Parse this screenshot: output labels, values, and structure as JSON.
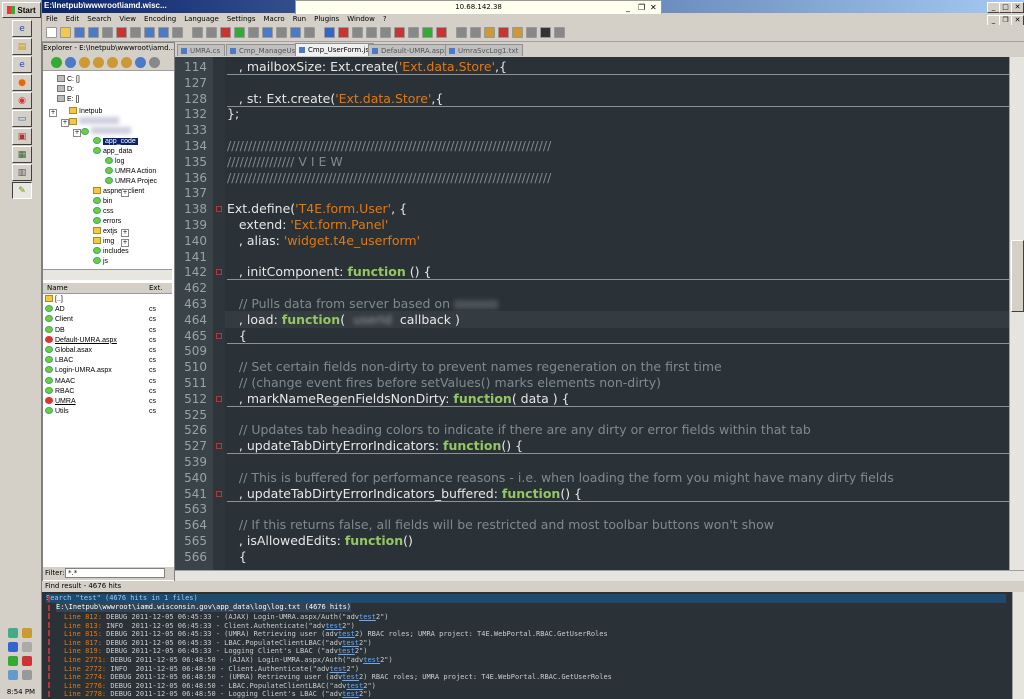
{
  "taskbar": {
    "start_label": "Start",
    "clock": "8:54 PM"
  },
  "remote": {
    "ip": "10.68.142.38"
  },
  "window": {
    "title": "E:\\Inetpub\\wwwroot\\iamd.wisc..."
  },
  "menu": [
    "File",
    "Edit",
    "Search",
    "View",
    "Encoding",
    "Language",
    "Settings",
    "Macro",
    "Run",
    "Plugins",
    "Window",
    "?"
  ],
  "explorer": {
    "title": "Explorer - E:\\Inetpub\\wwwroot\\iamd...",
    "tree": [
      {
        "label": "C: []",
        "depth": 0,
        "icon": "drive"
      },
      {
        "label": "D:",
        "depth": 0,
        "icon": "drive"
      },
      {
        "label": "E: []",
        "depth": 0,
        "icon": "drive"
      },
      {
        "label": "Inetpub",
        "depth": 1,
        "icon": "folder"
      },
      {
        "label": "app_code",
        "depth": 3,
        "icon": "check",
        "selected": true
      },
      {
        "label": "app_data",
        "depth": 3,
        "icon": "check"
      },
      {
        "label": "log",
        "depth": 4,
        "icon": "check"
      },
      {
        "label": "UMRA Action",
        "depth": 4,
        "icon": "check"
      },
      {
        "label": "UMRA Projec",
        "depth": 4,
        "icon": "check"
      },
      {
        "label": "aspnet_client",
        "depth": 3,
        "icon": "folder"
      },
      {
        "label": "bin",
        "depth": 3,
        "icon": "check"
      },
      {
        "label": "css",
        "depth": 3,
        "icon": "check"
      },
      {
        "label": "errors",
        "depth": 3,
        "icon": "check"
      },
      {
        "label": "extjs",
        "depth": 3,
        "icon": "folder"
      },
      {
        "label": "img",
        "depth": 3,
        "icon": "folder"
      },
      {
        "label": "includes",
        "depth": 3,
        "icon": "check"
      },
      {
        "label": "js",
        "depth": 3,
        "icon": "check"
      }
    ],
    "filelist_header": {
      "name": "Name",
      "ext": "Ext."
    },
    "files": [
      {
        "name": "[..]",
        "ext": ""
      },
      {
        "name": "AD",
        "ext": "cs"
      },
      {
        "name": "Client",
        "ext": "cs"
      },
      {
        "name": "DB",
        "ext": "cs"
      },
      {
        "name": "Default-UMRA.aspx",
        "ext": "cs"
      },
      {
        "name": "Global.asax",
        "ext": "cs"
      },
      {
        "name": "LBAC",
        "ext": "cs"
      },
      {
        "name": "Login-UMRA.aspx",
        "ext": "cs"
      },
      {
        "name": "MAAC",
        "ext": "cs"
      },
      {
        "name": "RBAC",
        "ext": "cs"
      },
      {
        "name": "UMRA",
        "ext": "cs"
      },
      {
        "name": "Utils",
        "ext": "cs"
      }
    ],
    "filter_label": "Filter:",
    "filter_value": "*.*"
  },
  "tabs": [
    "UMRA.cs",
    "Cmp_ManageUser.js",
    "Cmp_UserForm.js",
    "Default-UMRA.aspx.cs",
    "UmraSvcLog1.txt"
  ],
  "active_tab": 2,
  "find": {
    "title": "Find result - 4676 hits",
    "header": "Search \"test\" (4676 hits in 1 files)",
    "file": "E:\\Inetpub\\wwwroot\\iamd.wisconsin.gov\\app_data\\log\\log.txt (4676 hits)",
    "lines": [
      {
        "num": "Line 812:",
        "pre": " DEBUG 2011-12-05 06:45:33 - (AJAX) Login-UMRA.aspx/Auth(\"adv",
        "hit": "test",
        "post": "2\")"
      },
      {
        "num": "Line 813:",
        "pre": " INFO  2011-12-05 06:45:33 - Client.Authenticate(\"adv",
        "hit": "test",
        "post": "2\")"
      },
      {
        "num": "Line 815:",
        "pre": " DEBUG 2011-12-05 06:45:33 - (UMRA) Retrieving user (adv",
        "hit": "test",
        "post": "2) RBAC roles; UMRA project: T4E.WebPortal.RBAC.GetUserRoles"
      },
      {
        "num": "Line 817:",
        "pre": " DEBUG 2011-12-05 06:45:33 - LBAC.PopulateClientLBAC(\"adv",
        "hit": "test",
        "post": "2\")"
      },
      {
        "num": "Line 819:",
        "pre": " DEBUG 2011-12-05 06:45:33 - Logging Client's LBAC (\"adv",
        "hit": "test",
        "post": "2\")"
      },
      {
        "num": "Line 2771:",
        "pre": " DEBUG 2011-12-05 06:48:50 - (AJAX) Login-UMRA.aspx/Auth(\"adv",
        "hit": "test",
        "post": "2\")"
      },
      {
        "num": "Line 2772:",
        "pre": " INFO  2011-12-05 06:48:50 - Client.Authenticate(\"adv",
        "hit": "test",
        "post": "2\")"
      },
      {
        "num": "Line 2774:",
        "pre": " DEBUG 2011-12-05 06:48:50 - (UMRA) Retrieving user (adv",
        "hit": "test",
        "post": "2) RBAC roles; UMRA project: T4E.WebPortal.RBAC.GetUserRoles"
      },
      {
        "num": "Line 2776:",
        "pre": " DEBUG 2011-12-05 06:48:50 - LBAC.PopulateClientLBAC(\"adv",
        "hit": "test",
        "post": "2\")"
      },
      {
        "num": "Line 2778:",
        "pre": " DEBUG 2011-12-05 06:48:50 - Logging Client's LBAC (\"adv",
        "hit": "test",
        "post": "2\")"
      }
    ]
  },
  "code_lines": [
    {
      "n": "114",
      "segs": [
        [
          "t",
          "   , mailboxSize: Ext.create("
        ],
        [
          "s",
          "'Ext.data.Store'"
        ],
        [
          "t",
          ",{"
        ]
      ],
      "rule": true
    },
    {
      "n": "127",
      "segs": []
    },
    {
      "n": "128",
      "segs": [
        [
          "t",
          "   , st: Ext.create("
        ],
        [
          "s",
          "'Ext.data.Store'"
        ],
        [
          "t",
          ",{"
        ]
      ],
      "rule": true
    },
    {
      "n": "132",
      "segs": [
        [
          "t",
          "};"
        ]
      ]
    },
    {
      "n": "133",
      "segs": []
    },
    {
      "n": "134",
      "segs": [
        [
          "c",
          "/////////////////////////////////////////////////////////////////////////////"
        ]
      ]
    },
    {
      "n": "135",
      "segs": [
        [
          "c",
          "//////////////// V I E W"
        ]
      ]
    },
    {
      "n": "136",
      "segs": [
        [
          "c",
          "/////////////////////////////////////////////////////////////////////////////"
        ]
      ]
    },
    {
      "n": "137",
      "segs": []
    },
    {
      "n": "138",
      "segs": [
        [
          "t",
          "Ext.define("
        ],
        [
          "s",
          "'T4E.form.User'"
        ],
        [
          "t",
          ", {"
        ]
      ],
      "fold": true
    },
    {
      "n": "139",
      "segs": [
        [
          "t",
          "   extend: "
        ],
        [
          "s",
          "'Ext.form.Panel'"
        ]
      ]
    },
    {
      "n": "140",
      "segs": [
        [
          "t",
          "   , alias: "
        ],
        [
          "s",
          "'widget.t4e_userform'"
        ]
      ]
    },
    {
      "n": "141",
      "segs": []
    },
    {
      "n": "142",
      "segs": [
        [
          "t",
          "   , initComponent: "
        ],
        [
          "k",
          "function"
        ],
        [
          "t",
          " () {"
        ]
      ],
      "rule": true,
      "fold": true
    },
    {
      "n": "462",
      "segs": []
    },
    {
      "n": "463",
      "segs": [
        [
          "c",
          "   // Pulls data from server based on "
        ]
      ],
      "blur_after": true
    },
    {
      "n": "464",
      "segs": [
        [
          "t",
          "   , load: "
        ],
        [
          "k",
          "function"
        ],
        [
          "t",
          "(  "
        ],
        [
          "b",
          "userId"
        ],
        [
          "t",
          "  callback )"
        ]
      ]
    },
    {
      "n": "465",
      "segs": [
        [
          "t",
          "   {"
        ]
      ],
      "rule": true,
      "fold": true
    },
    {
      "n": "509",
      "segs": []
    },
    {
      "n": "510",
      "segs": [
        [
          "c",
          "   // Set certain fields non-dirty to prevent names regeneration on the first time"
        ]
      ]
    },
    {
      "n": "511",
      "segs": [
        [
          "c",
          "   // (change event fires before setValues() marks elements non-dirty)"
        ]
      ]
    },
    {
      "n": "512",
      "segs": [
        [
          "t",
          "   , markNameRegenFieldsNonDirty: "
        ],
        [
          "k",
          "function"
        ],
        [
          "t",
          "( data ) {"
        ]
      ],
      "rule": true,
      "fold": true
    },
    {
      "n": "525",
      "segs": []
    },
    {
      "n": "526",
      "segs": [
        [
          "c",
          "   // Updates tab heading colors to indicate if there are any dirty or error fields within that tab"
        ]
      ]
    },
    {
      "n": "527",
      "segs": [
        [
          "t",
          "   , updateTabDirtyErrorIndicators: "
        ],
        [
          "k",
          "function"
        ],
        [
          "t",
          "() {"
        ]
      ],
      "rule": true,
      "fold": true
    },
    {
      "n": "539",
      "segs": []
    },
    {
      "n": "540",
      "segs": [
        [
          "c",
          "   // This is buffered for performance reasons - i.e. when loading the form you might have many dirty fields"
        ]
      ]
    },
    {
      "n": "541",
      "segs": [
        [
          "t",
          "   , updateTabDirtyErrorIndicators_buffered: "
        ],
        [
          "k",
          "function"
        ],
        [
          "t",
          "() {"
        ]
      ],
      "rule": true,
      "fold": true
    },
    {
      "n": "563",
      "segs": []
    },
    {
      "n": "564",
      "segs": [
        [
          "c",
          "   // If this returns false, all fields will be restricted and most toolbar buttons won't show"
        ]
      ]
    },
    {
      "n": "565",
      "segs": [
        [
          "t",
          "   , isAllowedEdits: "
        ],
        [
          "k",
          "function"
        ],
        [
          "t",
          "()"
        ]
      ]
    },
    {
      "n": "566",
      "segs": [
        [
          "t",
          "   {"
        ]
      ]
    }
  ]
}
